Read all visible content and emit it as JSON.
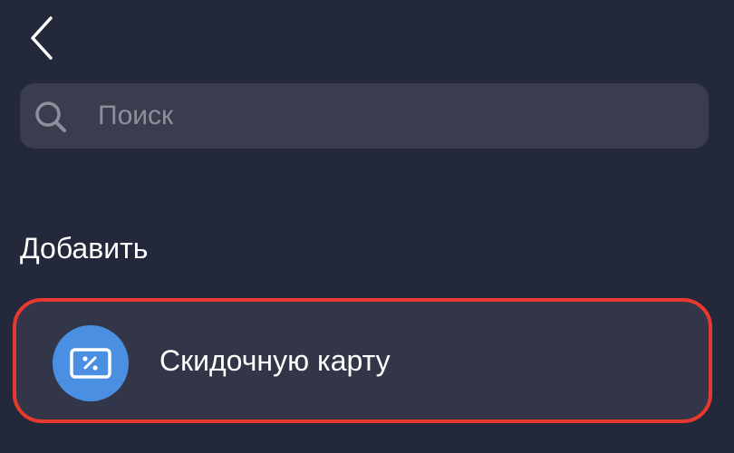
{
  "header": {
    "back_icon": "chevron-left-icon"
  },
  "search": {
    "placeholder": "Поиск",
    "icon": "search-icon"
  },
  "section": {
    "title": "Добавить"
  },
  "add_row": {
    "label": "Скидочную карту",
    "icon": "discount-card-icon",
    "highlighted": true
  },
  "colors": {
    "background": "#23283a",
    "search_background": "#393d4e",
    "row_background": "#323648",
    "highlight_border": "#e8392f",
    "icon_circle": "#4a8fe2",
    "placeholder_text": "#8d909c",
    "text": "#ffffff"
  }
}
